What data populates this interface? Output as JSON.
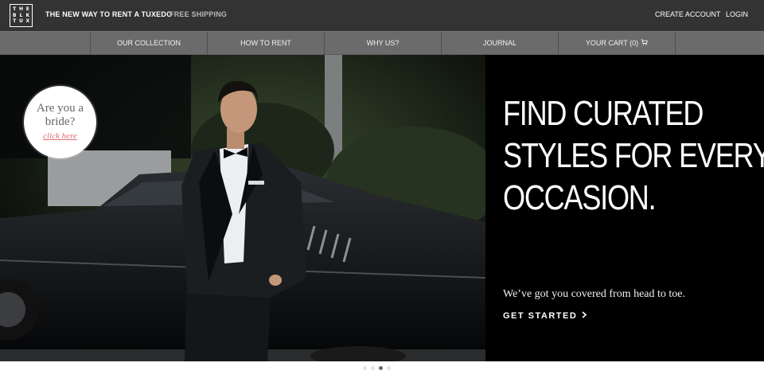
{
  "header": {
    "logo_letters": [
      "T",
      "H",
      "E",
      "B",
      "L",
      "K",
      "T",
      "U",
      "X"
    ],
    "tagline": "THE NEW WAY TO RENT A TUXEDO",
    "shipping": "FREE SHIPPING",
    "create_account": "CREATE ACCOUNT",
    "login": "LOGIN"
  },
  "nav": {
    "items": [
      {
        "label": "OUR COLLECTION"
      },
      {
        "label": "HOW TO RENT"
      },
      {
        "label": "WHY US?"
      },
      {
        "label": "JOURNAL"
      },
      {
        "label": "YOUR CART (0)",
        "icon": "cart-icon"
      }
    ]
  },
  "hero": {
    "headline_lines": [
      "FIND CURATED",
      "STYLES FOR EVERY",
      "OCCASION."
    ],
    "subline": "We’ve got you covered from head to toe.",
    "cta": "GET STARTED",
    "cta_icon": "chevron-right-icon",
    "badge": {
      "question_line1": "Are you a",
      "question_line2": "bride?",
      "link": "click here"
    }
  },
  "carousel": {
    "slide_count": 4,
    "active_index": 2
  },
  "colors": {
    "topbar": "#333333",
    "navbar": "#6b6b6b",
    "hero_bg": "#000000",
    "badge_link": "#e06a73"
  }
}
